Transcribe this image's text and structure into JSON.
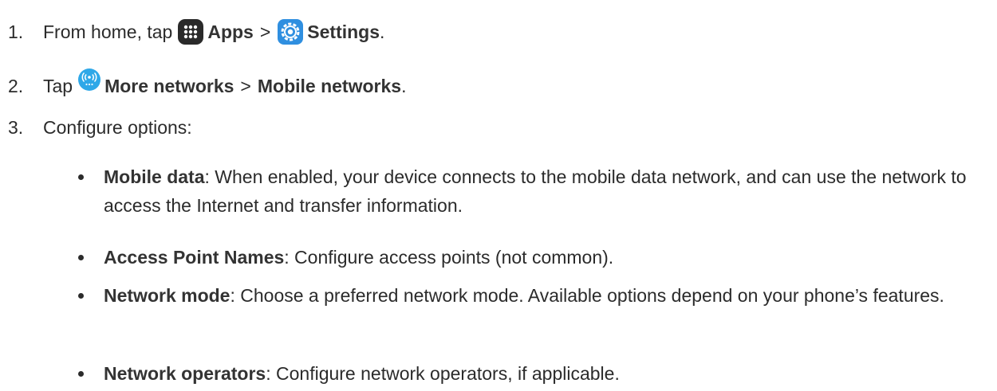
{
  "steps": [
    {
      "number": "1.",
      "prefix": "From home, tap",
      "apps_label": "Apps",
      "separator": ">",
      "settings_label": "Settings",
      "suffix": "."
    },
    {
      "number": "2.",
      "prefix": "Tap",
      "more_networks_label": "More networks",
      "separator": ">",
      "mobile_networks_label": "Mobile networks",
      "suffix": "."
    },
    {
      "number": "3.",
      "text": "Configure options:"
    }
  ],
  "options": [
    {
      "term": "Mobile data",
      "description": ": When enabled, your device connects to the mobile data network, and can use the network to access the Internet and transfer information."
    },
    {
      "term": "Access Point Names",
      "description": ": Configure access points (not common)."
    },
    {
      "term": "Network mode",
      "description": ": Choose a preferred network mode. Available options depend on your phone’s features."
    },
    {
      "term": "Network operators",
      "description": ": Configure network operators, if applicable."
    }
  ],
  "icons": {
    "apps": "apps-grid-icon",
    "settings": "settings-gear-icon",
    "more_networks": "more-networks-icon"
  },
  "colors": {
    "text": "#2b2b2b",
    "apps_icon_bg": "#2a2a2a",
    "settings_icon_bg": "#2f8fe0",
    "more_networks_icon_bg": "#2fa8e8"
  }
}
